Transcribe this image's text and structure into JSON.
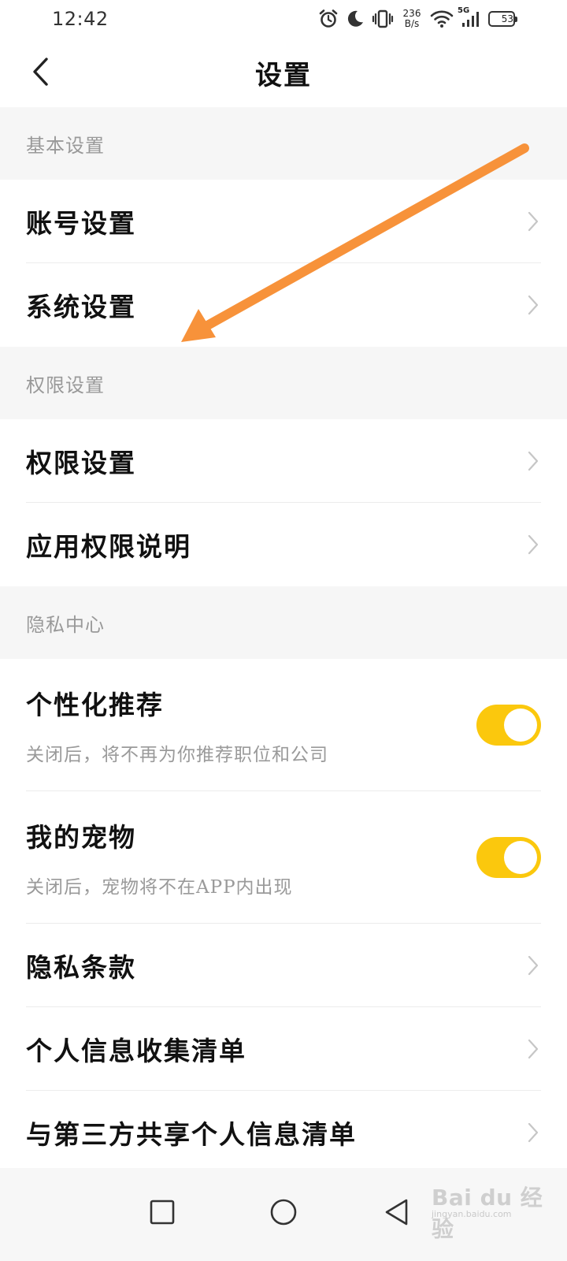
{
  "status_bar": {
    "time": "12:42",
    "net_speed_value": "236",
    "net_speed_unit": "B/s",
    "network_type": "5G",
    "battery_level": "53",
    "icons": [
      "alarm-icon",
      "moon-icon",
      "vibrate-icon",
      "wifi-icon",
      "cellular-signal-icon",
      "battery-icon"
    ]
  },
  "header": {
    "title": "设置",
    "back_icon": "chevron-left-icon"
  },
  "sections": {
    "basic": {
      "title": "基本设置",
      "items": [
        {
          "label": "账号设置"
        },
        {
          "label": "系统设置"
        }
      ]
    },
    "permission": {
      "title": "权限设置",
      "items": [
        {
          "label": "权限设置"
        },
        {
          "label": "应用权限说明"
        }
      ]
    },
    "privacy": {
      "title": "隐私中心",
      "toggles": [
        {
          "label": "个性化推荐",
          "description": "关闭后，将不再为你推荐职位和公司",
          "enabled": true
        },
        {
          "label": "我的宠物",
          "description": "关闭后，宠物将不在APP内出现",
          "enabled": true
        }
      ],
      "items": [
        {
          "label": "隐私条款"
        },
        {
          "label": "个人信息收集清单"
        },
        {
          "label": "与第三方共享个人信息清单"
        }
      ]
    }
  },
  "colors": {
    "toggle_on": "#fbc80d",
    "section_bg": "#f6f6f6",
    "annotation_arrow": "#f7923a"
  },
  "nav_bar": {
    "icons": [
      "recent-apps-icon",
      "home-icon",
      "back-icon"
    ]
  },
  "watermark": {
    "main": "Bai du 经验",
    "sub": "jingyan.baidu.com"
  }
}
